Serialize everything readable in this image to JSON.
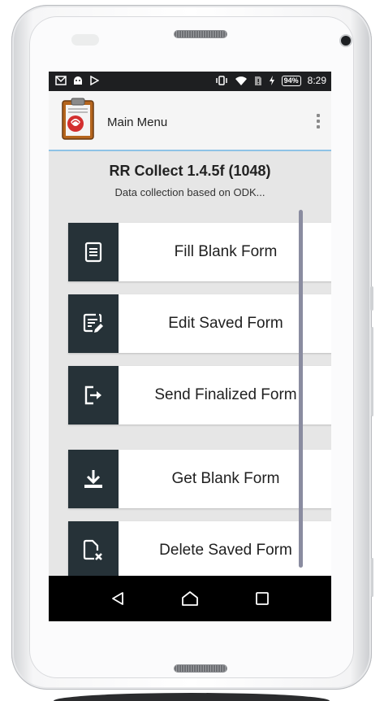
{
  "status_bar": {
    "left_icons": [
      "mail-icon",
      "android-icon",
      "play-icon"
    ],
    "right_icons": [
      "vibrate-icon",
      "wifi-icon",
      "sim-icon",
      "charging-icon"
    ],
    "battery": "94%",
    "time": "8:29"
  },
  "app_bar": {
    "title": "Main Menu",
    "menu_icon": "overflow-menu-icon"
  },
  "header": {
    "title": "RR Collect 1.4.5f (1048)",
    "subtitle": "Data collection based on ODK..."
  },
  "menu": [
    {
      "label": "Fill Blank Form",
      "icon": "form-icon"
    },
    {
      "label": "Edit Saved Form",
      "icon": "edit-form-icon"
    },
    {
      "label": "Send Finalized Form",
      "icon": "send-icon"
    },
    {
      "label": "Get Blank Form",
      "icon": "download-icon"
    },
    {
      "label": "Delete Saved Form",
      "icon": "delete-file-icon"
    }
  ],
  "nav_bar": {
    "back": "back-icon",
    "home": "home-icon",
    "recents": "recents-icon"
  },
  "colors": {
    "icon_tile": "#263238",
    "app_bar_divider": "#8ec3e6",
    "background": "#e6e6e6"
  }
}
